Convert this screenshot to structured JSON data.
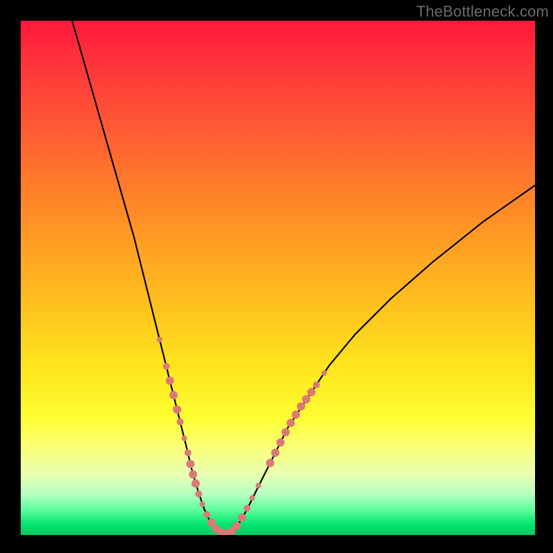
{
  "watermark": "TheBottleneck.com",
  "chart_data": {
    "type": "line",
    "title": "",
    "xlabel": "",
    "ylabel": "",
    "xlim": [
      0,
      100
    ],
    "ylim": [
      0,
      100
    ],
    "series": [
      {
        "name": "curve",
        "x": [
          10,
          14,
          18,
          22,
          25,
          27,
          29,
          30.5,
          32,
          33.2,
          34.5,
          35.7,
          37,
          38.2,
          39.5,
          41,
          42.5,
          44,
          46,
          49,
          52,
          56,
          60,
          65,
          72,
          80,
          90,
          100
        ],
        "values": [
          100,
          86,
          72,
          58,
          46,
          38,
          30,
          24,
          18,
          13,
          8.5,
          5,
          2.2,
          0.8,
          0.2,
          0.7,
          2.4,
          5,
          9,
          15,
          21,
          27,
          33,
          39,
          46,
          53,
          61,
          68
        ]
      }
    ],
    "markers": [
      {
        "x": 27.0,
        "y": 38.0,
        "r": 4
      },
      {
        "x": 28.3,
        "y": 32.8,
        "r": 5
      },
      {
        "x": 29.0,
        "y": 30.0,
        "r": 6
      },
      {
        "x": 29.7,
        "y": 27.2,
        "r": 6
      },
      {
        "x": 30.4,
        "y": 24.4,
        "r": 6
      },
      {
        "x": 31.0,
        "y": 22.0,
        "r": 5
      },
      {
        "x": 31.8,
        "y": 18.8,
        "r": 4
      },
      {
        "x": 32.5,
        "y": 16.0,
        "r": 5
      },
      {
        "x": 33.0,
        "y": 13.8,
        "r": 6
      },
      {
        "x": 33.5,
        "y": 11.8,
        "r": 6
      },
      {
        "x": 34.0,
        "y": 10.0,
        "r": 6
      },
      {
        "x": 34.6,
        "y": 8.0,
        "r": 5
      },
      {
        "x": 35.3,
        "y": 6.0,
        "r": 4
      },
      {
        "x": 36.2,
        "y": 4.0,
        "r": 5
      },
      {
        "x": 37.1,
        "y": 2.4,
        "r": 6
      },
      {
        "x": 38.0,
        "y": 1.2,
        "r": 6
      },
      {
        "x": 39.0,
        "y": 0.5,
        "r": 6
      },
      {
        "x": 40.0,
        "y": 0.3,
        "r": 6
      },
      {
        "x": 41.0,
        "y": 0.7,
        "r": 6
      },
      {
        "x": 42.0,
        "y": 1.8,
        "r": 6
      },
      {
        "x": 43.0,
        "y": 3.4,
        "r": 6
      },
      {
        "x": 44.0,
        "y": 5.2,
        "r": 5
      },
      {
        "x": 45.0,
        "y": 7.2,
        "r": 4
      },
      {
        "x": 46.2,
        "y": 9.6,
        "r": 4
      },
      {
        "x": 48.5,
        "y": 14.0,
        "r": 6
      },
      {
        "x": 49.5,
        "y": 16.0,
        "r": 6
      },
      {
        "x": 50.5,
        "y": 18.0,
        "r": 6
      },
      {
        "x": 51.5,
        "y": 20.0,
        "r": 6
      },
      {
        "x": 52.5,
        "y": 21.8,
        "r": 6
      },
      {
        "x": 53.5,
        "y": 23.4,
        "r": 6
      },
      {
        "x": 54.5,
        "y": 25.0,
        "r": 6
      },
      {
        "x": 55.5,
        "y": 26.4,
        "r": 6
      },
      {
        "x": 56.5,
        "y": 27.8,
        "r": 6
      },
      {
        "x": 57.5,
        "y": 29.2,
        "r": 5
      },
      {
        "x": 59.0,
        "y": 31.5,
        "r": 4
      }
    ]
  }
}
